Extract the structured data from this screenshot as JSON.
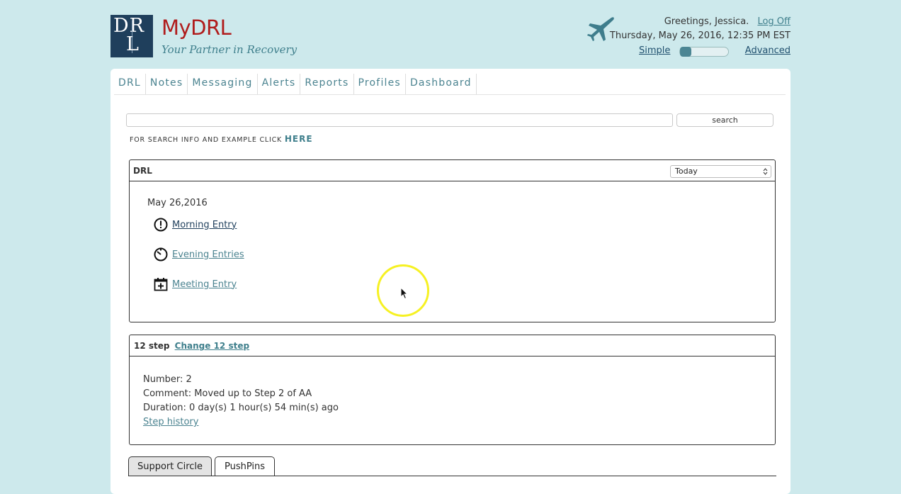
{
  "header": {
    "logo_text_top": "DR",
    "logo_text_bottom": "L",
    "brand_title": "MyDRL",
    "brand_tagline": "Your Partner in Recovery",
    "greeting": "Greetings, Jessica.",
    "logoff_label": "Log Off",
    "datetime": "Thursday, May 26, 2016, 12:35 PM EST",
    "mode_simple_label": "Simple",
    "mode_advanced_label": "Advanced",
    "mode_slider_position": 0
  },
  "nav": {
    "items": [
      {
        "label": "DRL"
      },
      {
        "label": "Notes"
      },
      {
        "label": "Messaging"
      },
      {
        "label": "Alerts"
      },
      {
        "label": "Reports"
      },
      {
        "label": "Profiles"
      },
      {
        "label": "Dashboard"
      }
    ]
  },
  "search": {
    "value": "",
    "button_label": "search",
    "info_text": "FOR SEARCH INFO AND EXAMPLE CLICK ",
    "info_link": "HERE"
  },
  "drl_box": {
    "title": "DRL",
    "range_selected": "Today",
    "date": "May 26,2016",
    "entries": [
      {
        "label": "Morning Entry",
        "icon": "alert-circle-icon"
      },
      {
        "label": "Evening Entries",
        "icon": "clock-icon"
      },
      {
        "label": "Meeting Entry",
        "icon": "calendar-add-icon"
      }
    ]
  },
  "step_box": {
    "title": "12 step",
    "change_label": "Change 12 step",
    "number_line": "Number: 2",
    "comment_line": "Comment: Moved up to Step 2 of AA",
    "duration_line": "Duration: 0 day(s) 1 hour(s) 54 min(s) ago",
    "history_label": "Step history"
  },
  "tabs": [
    {
      "label": "Support Circle",
      "active": true
    },
    {
      "label": "PushPins",
      "active": false
    }
  ],
  "colors": {
    "background": "#cde9ec",
    "brand_red": "#b01c1c",
    "accent_teal": "#3f7f8c",
    "logo_navy": "#1f3f5c"
  }
}
